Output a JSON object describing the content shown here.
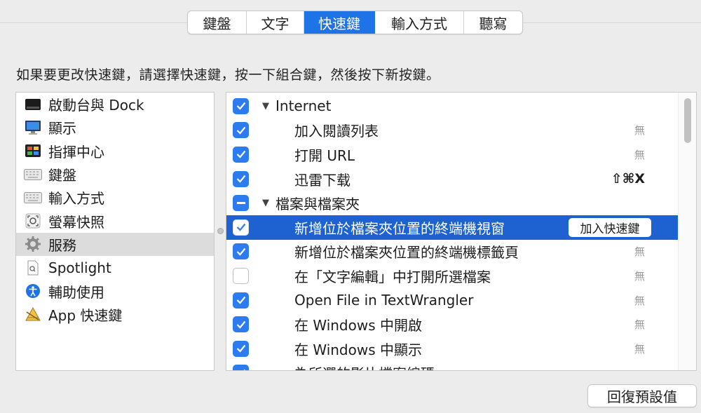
{
  "tabs": [
    {
      "label": "鍵盤",
      "active": false
    },
    {
      "label": "文字",
      "active": false
    },
    {
      "label": "快速鍵",
      "active": true
    },
    {
      "label": "輸入方式",
      "active": false
    },
    {
      "label": "聽寫",
      "active": false
    }
  ],
  "instruction": "如果要更改快速鍵，請選擇快速鍵，按一下組合鍵，然後按下新按鍵。",
  "categories": [
    {
      "label": "啟動台與 Dock",
      "icon": "launchpad-dock-icon"
    },
    {
      "label": "顯示",
      "icon": "display-icon"
    },
    {
      "label": "指揮中心",
      "icon": "mission-control-icon"
    },
    {
      "label": "鍵盤",
      "icon": "keyboard-icon"
    },
    {
      "label": "輸入方式",
      "icon": "input-sources-icon"
    },
    {
      "label": "螢幕快照",
      "icon": "screenshot-icon"
    },
    {
      "label": "服務",
      "icon": "services-gear-icon",
      "selected": true
    },
    {
      "label": "Spotlight",
      "icon": "spotlight-icon"
    },
    {
      "label": "輔助使用",
      "icon": "accessibility-icon"
    },
    {
      "label": "App 快速鍵",
      "icon": "app-shortcuts-icon"
    }
  ],
  "shortcuts": [
    {
      "label": "Internet",
      "type": "group",
      "checkbox": "on",
      "shortcut": ""
    },
    {
      "label": "加入閱讀列表",
      "type": "item",
      "checkbox": "on",
      "shortcut": "無"
    },
    {
      "label": "打開 URL",
      "type": "item",
      "checkbox": "on",
      "shortcut": "無"
    },
    {
      "label": "迅雷下载",
      "type": "item",
      "checkbox": "on",
      "shortcut": "⇧⌘X"
    },
    {
      "label": "檔案與檔案夾",
      "type": "group",
      "checkbox": "mixed",
      "shortcut": ""
    },
    {
      "label": "新增位於檔案夾位置的終端機視窗",
      "type": "item",
      "checkbox": "on",
      "selected": true,
      "button": "加入快速鍵"
    },
    {
      "label": "新增位於檔案夾位置的終端機標籤頁",
      "type": "item",
      "checkbox": "on",
      "shortcut": "無"
    },
    {
      "label": "在「文字編輯」中打開所選檔案",
      "type": "item",
      "checkbox": "off",
      "shortcut": "無"
    },
    {
      "label": "Open File in TextWrangler",
      "type": "item",
      "checkbox": "on",
      "shortcut": "無"
    },
    {
      "label": "在 Windows 中開啟",
      "type": "item",
      "checkbox": "on",
      "shortcut": "無"
    },
    {
      "label": "在 Windows 中顯示",
      "type": "item",
      "checkbox": "on",
      "shortcut": "無"
    },
    {
      "label": "為所選的影片檔案編碼",
      "type": "item",
      "checkbox": "on",
      "shortcut": ""
    }
  ],
  "restore_button": "回復預設值",
  "colors": {
    "accent": "#1e73e6",
    "selection": "#1e62d1",
    "checkbox": "#2c7cf0"
  }
}
